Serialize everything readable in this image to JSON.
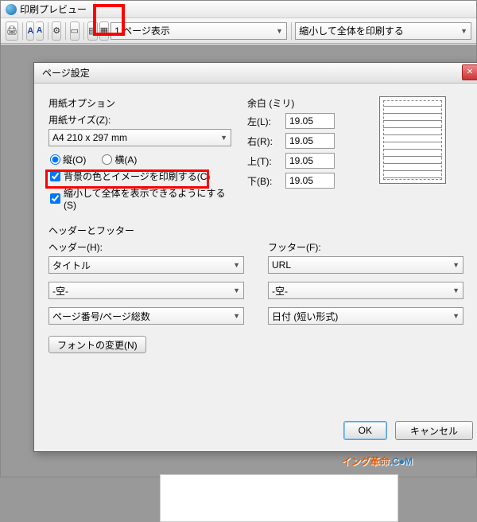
{
  "window": {
    "title": "印刷プレビュー"
  },
  "toolbar": {
    "page_display": "1 ページ表示",
    "shrink_fit": "縮小して全体を印刷する"
  },
  "dialog": {
    "title": "ページ設定",
    "paper": {
      "group": "用紙オプション",
      "size_label": "用紙サイズ(Z):",
      "size_value": "A4 210 x 297 mm",
      "orient_portrait": "縦(O)",
      "orient_landscape": "横(A)",
      "print_bg": "背景の色とイメージを印刷する(C)",
      "shrink_view": "縮小して全体を表示できるようにする(S)"
    },
    "margins": {
      "group": "余白 (ミリ)",
      "left": "左(L):",
      "right": "右(R):",
      "top": "上(T):",
      "bottom": "下(B):",
      "val_left": "19.05",
      "val_right": "19.05",
      "val_top": "19.05",
      "val_bottom": "19.05"
    },
    "hf": {
      "group": "ヘッダーとフッター",
      "header_label": "ヘッダー(H):",
      "footer_label": "フッター(F):",
      "h1": "タイトル",
      "h2": "-空-",
      "h3": "ページ番号/ページ総数",
      "f1": "URL",
      "f2": "-空-",
      "f3": "日付 (短い形式)"
    },
    "font_btn": "フォントの変更(N)",
    "ok": "OK",
    "cancel": "キャンセル"
  },
  "footer_logo": {
    "a": "イング革命",
    "b": ".C●M"
  }
}
